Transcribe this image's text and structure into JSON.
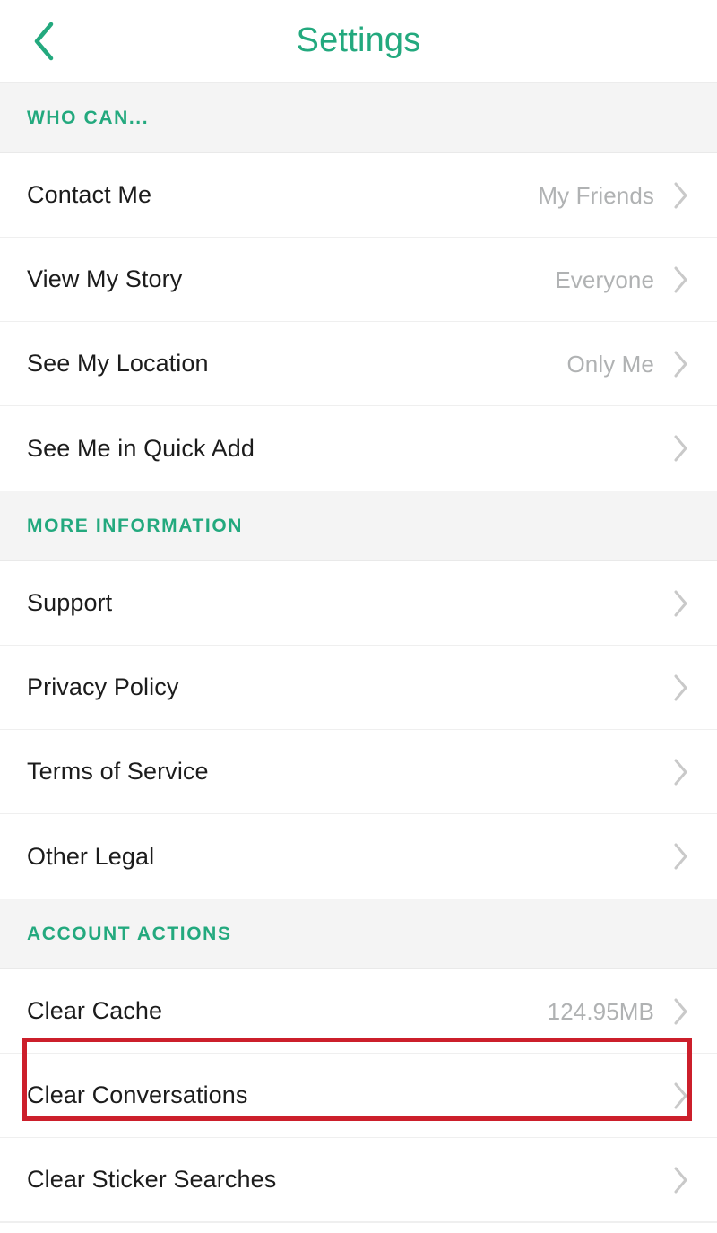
{
  "navbar": {
    "back_icon": "chevron-left-icon",
    "title": "Settings",
    "accent_color": "#23A97E"
  },
  "sections": [
    {
      "header": "WHO CAN...",
      "rows": [
        {
          "label": "Contact Me",
          "value": "My Friends",
          "chevron": "chevron-right-icon"
        },
        {
          "label": "View My Story",
          "value": "Everyone",
          "chevron": "chevron-right-icon"
        },
        {
          "label": "See My Location",
          "value": "Only Me",
          "chevron": "chevron-right-icon"
        },
        {
          "label": "See Me in Quick Add",
          "value": "",
          "chevron": "chevron-right-icon"
        }
      ]
    },
    {
      "header": "MORE INFORMATION",
      "rows": [
        {
          "label": "Support",
          "value": "",
          "chevron": "chevron-right-icon"
        },
        {
          "label": "Privacy Policy",
          "value": "",
          "chevron": "chevron-right-icon"
        },
        {
          "label": "Terms of Service",
          "value": "",
          "chevron": "chevron-right-icon"
        },
        {
          "label": "Other Legal",
          "value": "",
          "chevron": "chevron-right-icon"
        }
      ]
    },
    {
      "header": "ACCOUNT ACTIONS",
      "rows": [
        {
          "label": "Clear Cache",
          "value": "124.95MB",
          "chevron": "chevron-right-icon"
        },
        {
          "label": "Clear Conversations",
          "value": "",
          "chevron": "chevron-right-icon"
        },
        {
          "label": "Clear Sticker Searches",
          "value": "",
          "chevron": "chevron-right-icon"
        }
      ]
    }
  ],
  "highlight": {
    "target_label": "Clear Conversations",
    "color": "#CC1F2B"
  },
  "colors": {
    "accent_green": "#23A97E",
    "section_band": "#F4F4F4",
    "row_label": "#1C1C1C",
    "row_value": "#B0B2B3",
    "chevron": "#C9C9C9",
    "divider": "#EFEFEF",
    "highlight_red": "#CC1F2B"
  }
}
